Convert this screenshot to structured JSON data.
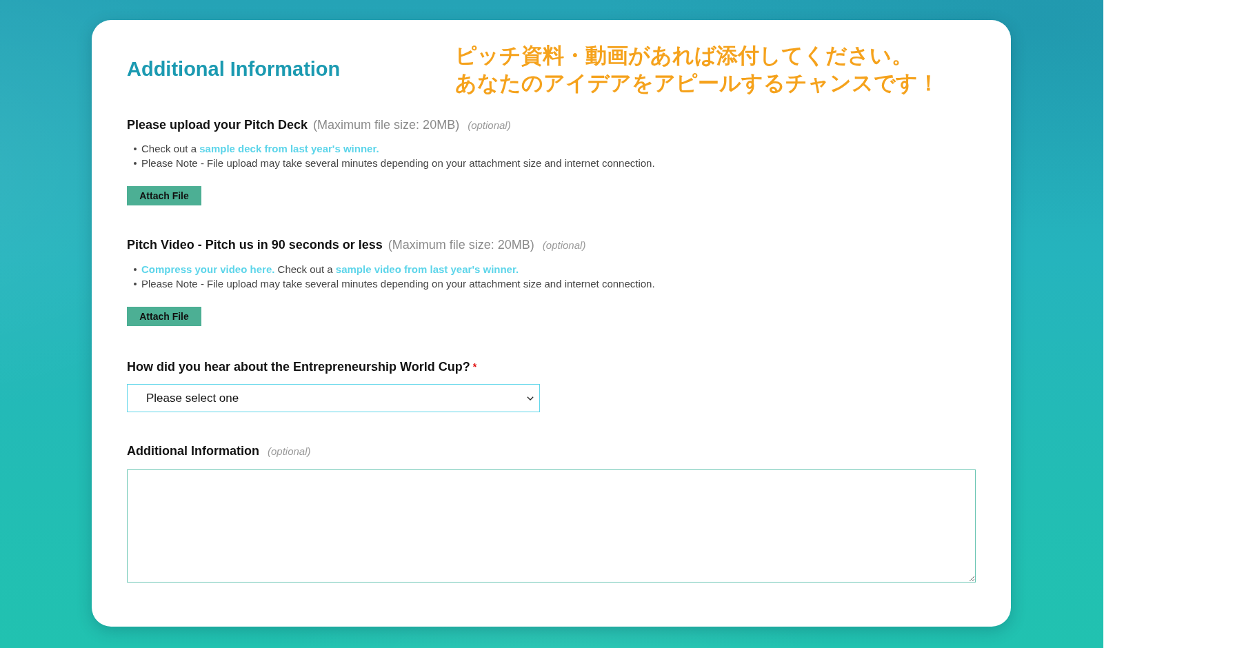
{
  "header": {
    "title": "Additional Information",
    "promo_lines": [
      "ピッチ資料・動画があれば添付してください。",
      "あなたのアイデアをアピールするチャンスです！"
    ]
  },
  "upload_sections": [
    {
      "label": "Please upload your Pitch Deck",
      "size_note": "(Maximum file size: 20MB)",
      "optional_note": "(optional)",
      "notes": [
        [
          {
            "kind": "text",
            "text": "Check out a "
          },
          {
            "kind": "link",
            "text": "sample deck from last year's winner."
          }
        ],
        [
          {
            "kind": "text",
            "text": "Please Note - File upload may take several minutes depending on your attachment size and internet connection."
          }
        ]
      ],
      "button": "Attach File"
    },
    {
      "label": "Pitch Video - Pitch us in 90 seconds or less",
      "size_note": "(Maximum file size: 20MB)",
      "optional_note": "(optional)",
      "notes": [
        [
          {
            "kind": "link",
            "text": "Compress your video here."
          },
          {
            "kind": "text",
            "text": " Check out a "
          },
          {
            "kind": "link",
            "text": "sample video from last year's winner."
          }
        ],
        [
          {
            "kind": "text",
            "text": "Please Note - File upload may take several minutes depending on your attachment size and internet connection."
          }
        ]
      ],
      "button": "Attach File"
    }
  ],
  "referral_question": {
    "label": "How did you hear about the Entrepreneurship World Cup?",
    "required_mark": "*",
    "select_value": "Please select one"
  },
  "additional_info": {
    "label": "Additional Information",
    "optional_note": "(optional)"
  }
}
